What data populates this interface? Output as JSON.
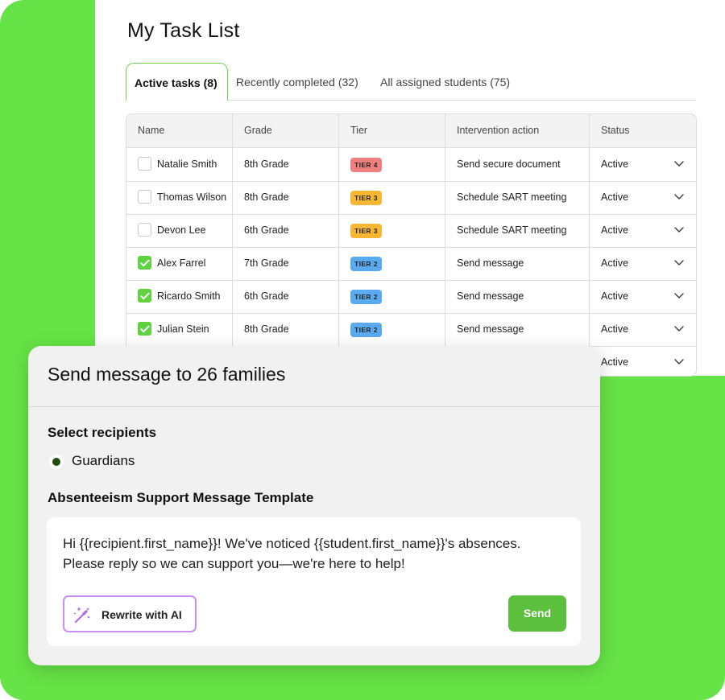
{
  "page": {
    "title": "My Task List",
    "tabs": [
      {
        "label": "Active tasks (8)",
        "active": true
      },
      {
        "label": "Recently completed (32)",
        "active": false
      },
      {
        "label": "All assigned students (75)",
        "active": false
      }
    ]
  },
  "table": {
    "headers": [
      "Name",
      "Grade",
      "Tier",
      "Intervention action",
      "Status"
    ],
    "rows": [
      {
        "name": "Natalie Smith",
        "grade": "8th Grade",
        "tier": "TIER 4",
        "tier_color": "#f08080",
        "action": "Send secure document",
        "status": "Active",
        "checked": false
      },
      {
        "name": "Thomas Wilson",
        "grade": "8th Grade",
        "tier": "TIER 3",
        "tier_color": "#f7b733",
        "action": "Schedule SART meeting",
        "status": "Active",
        "checked": false
      },
      {
        "name": "Devon Lee",
        "grade": "6th Grade",
        "tier": "TIER 3",
        "tier_color": "#f7b733",
        "action": "Schedule SART meeting",
        "status": "Active",
        "checked": false
      },
      {
        "name": "Alex Farrel",
        "grade": "7th Grade",
        "tier": "TIER 2",
        "tier_color": "#5aaaf0",
        "action": "Send message",
        "status": "Active",
        "checked": true
      },
      {
        "name": "Ricardo Smith",
        "grade": "6th Grade",
        "tier": "TIER 2",
        "tier_color": "#5aaaf0",
        "action": "Send message",
        "status": "Active",
        "checked": true
      },
      {
        "name": "Julian Stein",
        "grade": "8th Grade",
        "tier": "TIER 2",
        "tier_color": "#5aaaf0",
        "action": "Send message",
        "status": "Active",
        "checked": true
      },
      {
        "name": "",
        "grade": "",
        "tier": "",
        "tier_color": "",
        "action": "",
        "status": "Active",
        "checked": true
      }
    ]
  },
  "modal": {
    "title": "Send message to 26 families",
    "recipients_label": "Select recipients",
    "recipient_option": "Guardians",
    "template_label": "Absenteeism Support Message Template",
    "message": "Hi {{recipient.first_name}}! We've noticed {{student.first_name}}'s absences. Please reply so we can support you—we're here to help!",
    "rewrite_label": "Rewrite with AI",
    "send_label": "Send"
  },
  "colors": {
    "brand_green": "#66e346",
    "send_button": "#5cbf3e",
    "checkbox_checked": "#5ed23f",
    "ai_button_border": "#c98ef2"
  },
  "icons": {
    "ai_button": "magic-wand-sparkles-icon",
    "row_toggle": "chevron-down-icon"
  }
}
